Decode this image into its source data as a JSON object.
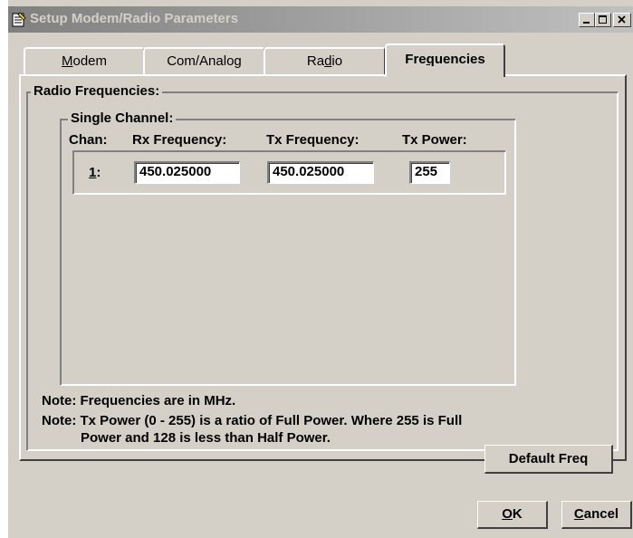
{
  "window": {
    "title": "Setup Modem/Radio Parameters",
    "icon": "notepad-icon"
  },
  "title_buttons": {
    "minimize": "minimize-icon",
    "maximize": "maximize-icon",
    "close": "close-icon"
  },
  "tabs": [
    {
      "label_pre": "",
      "label_u": "M",
      "label_post": "odem",
      "active": false
    },
    {
      "label_pre": "Com/Analo",
      "label_u": "g",
      "label_post": "",
      "active": false
    },
    {
      "label_pre": "Ra",
      "label_u": "d",
      "label_post": "io",
      "active": false
    },
    {
      "label_pre": "Fre",
      "label_u": "q",
      "label_post": "uencies",
      "active": true
    }
  ],
  "radio_frequencies": {
    "legend": "Radio Frequencies:",
    "single_channel": {
      "legend": "Single Channel:",
      "headers": {
        "chan": "Chan:",
        "rx": "Rx Frequency:",
        "tx": "Tx Frequency:",
        "power": "Tx Power:"
      },
      "rows": [
        {
          "chan_u": "1",
          "chan_post": ":",
          "rx": "450.025000",
          "tx": "450.025000",
          "power": "255"
        }
      ]
    },
    "note1": "Note: Frequencies are in MHz.",
    "note2_line1": "Note: Tx Power (0 - 255) is a ratio of Full Power.  Where 255 is Full",
    "note2_line2": "Power and 128 is less than Half Power.",
    "default_button": "Default Freq"
  },
  "buttons": {
    "ok_u": "O",
    "ok_post": "K",
    "cancel_u": "C",
    "cancel_post": "ancel"
  }
}
